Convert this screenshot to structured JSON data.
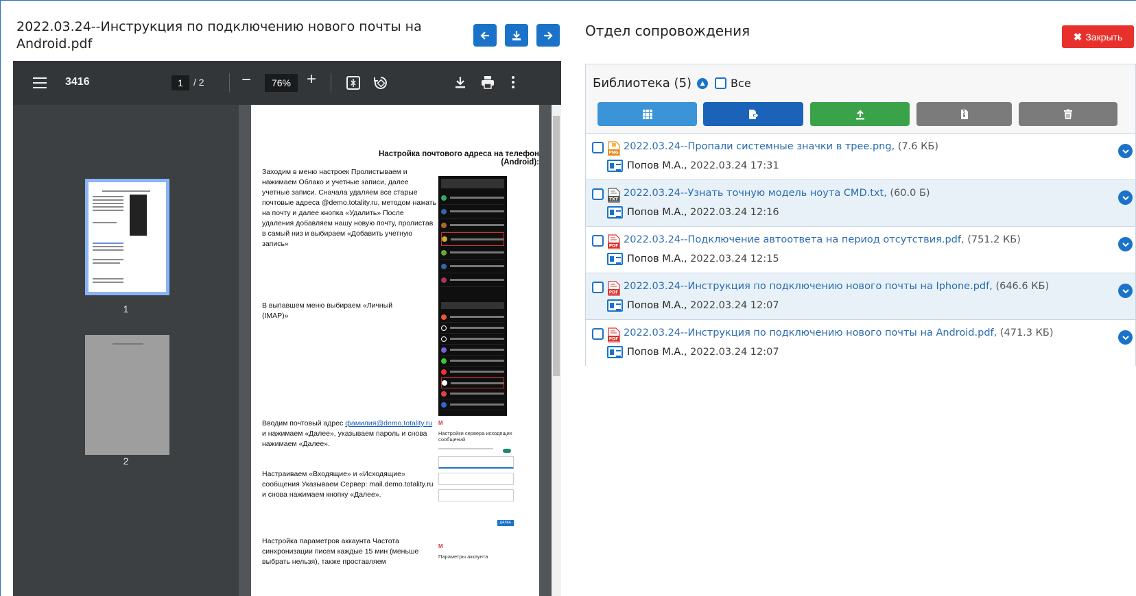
{
  "document": {
    "title": "2022.03.24--Инструкция по подключению нового почты на Android.pdf",
    "nav": {
      "prev_icon": "arrow-left-icon",
      "download_icon": "download-icon",
      "next_icon": "arrow-right-icon"
    }
  },
  "viewer": {
    "doc_name": "3416",
    "current_page": "1",
    "page_count": "/ 2",
    "zoom": "76%",
    "minus": "−",
    "plus": "+",
    "thumbnails": [
      {
        "label": "1"
      },
      {
        "label": "2"
      }
    ],
    "page": {
      "heading": "Настройка почтового адреса на телефон (Android):",
      "para1": "Заходим в меню настроек Пролистываем и нажимаем Облако и учетные записи, далее учетные записи. Сначала удаляем все старые почтовые адреса @demo.totality.ru, методом нажать на почту и далее кнопка «Удалить» После удаления добавляем нашу новую почту, пролистав в самый низ и выбираем «Добавить учетную запись»",
      "para2": "В выпавшем меню выбираем «Личный (IMAP)»",
      "para3_pre": "Вводим почтовый адрес",
      "para3_link": "фамилия@demo.totality.ru",
      "para3_post": "и нажимаем «Далее», указываем пароль и снова нажимаем «Далее».",
      "para4": "Настраиваем «Входящие» и «Исходящие» сообщения Указываем Сервер: mail.demo.totality.ru и снова нажимаем кнопку «Далее».",
      "para5": "Настройка параметров аккаунта Частота синхронизации писем каждые 15 мин (меньше выбрать нельзя), также проставляем",
      "gmail1_title": "Настройки сервера исходящих сообщений",
      "gmail1_button": "ДАЛЕЕ",
      "gmail2_title": "Параметры аккаунта"
    }
  },
  "department": {
    "title": "Отдел сопровождения",
    "close_label": "Закрыть",
    "close_glyph": "✖"
  },
  "library": {
    "title": "Библиотека (5)",
    "all_label": "Все",
    "toolbar": [
      {
        "name": "grid-view-button",
        "icon": "grid-icon",
        "color": "#3b93d8"
      },
      {
        "name": "export-button",
        "icon": "file-export-icon",
        "color": "#1a63b8"
      },
      {
        "name": "upload-button",
        "icon": "upload-icon",
        "color": "#3aa34a"
      },
      {
        "name": "archive-button",
        "icon": "file-zip-icon",
        "color": "#7b7b7b"
      },
      {
        "name": "delete-button",
        "icon": "trash-icon",
        "color": "#7b7b7b"
      }
    ],
    "files": [
      {
        "name": "2022.03.24--Пропали системные значки в трее.png",
        "size": "(7.6 КБ)",
        "type": "png",
        "author": "Попов М.А.",
        "date": "2022.03.24 17:31"
      },
      {
        "name": "2022.03.24--Узнать точную модель ноута CMD.txt",
        "size": "(60.0 Б)",
        "type": "txt",
        "author": "Попов М.А.",
        "date": "2022.03.24 12:16"
      },
      {
        "name": "2022.03.24--Подключение автоответа на период отсутствия.pdf",
        "size": "(751.2 КБ)",
        "type": "pdf",
        "author": "Попов М.А.",
        "date": "2022.03.24 12:15"
      },
      {
        "name": "2022.03.24--Инструкция по подключению нового почты на Iphone.pdf",
        "size": "(646.6 КБ)",
        "type": "pdf",
        "author": "Попов М.А.",
        "date": "2022.03.24 12:07"
      },
      {
        "name": "2022.03.24--Инструкция по подключению нового почты на Android.pdf",
        "size": "(471.3 КБ)",
        "type": "pdf",
        "author": "Попов М.А.",
        "date": "2022.03.24 12:07"
      }
    ]
  },
  "colors": {
    "accent": "#1a73c9",
    "danger": "#e8312c",
    "row_alt": "#e8f1f8"
  }
}
